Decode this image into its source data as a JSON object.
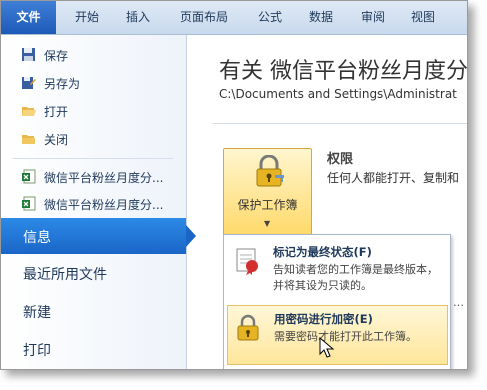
{
  "tabs": [
    {
      "label": "文件"
    },
    {
      "label": "开始"
    },
    {
      "label": "插入"
    },
    {
      "label": "页面布局"
    },
    {
      "label": "公式"
    },
    {
      "label": "数据"
    },
    {
      "label": "审阅"
    },
    {
      "label": "视图"
    }
  ],
  "menu": {
    "save": "保存",
    "save_as": "另存为",
    "open": "打开",
    "close": "关闭",
    "recent1": "微信平台粉丝月度分...",
    "recent2": "微信平台粉丝月度分...",
    "info": "信息",
    "recent_files": "最近所用文件",
    "new": "新建",
    "print": "打印"
  },
  "main": {
    "title": "有关 微信平台粉丝月度分",
    "path": "C:\\Documents and Settings\\Administrat",
    "protect_label": "保护工作簿",
    "perm_title": "权限",
    "perm_desc": "任何人都能打开、复制和"
  },
  "dropdown": {
    "mark_final_title": "标记为最终状态(F)",
    "mark_final_desc": "告知读者您的工作簿是最终版本，并将其设为只读的。",
    "encrypt_title": "用密码进行加密(E)",
    "encrypt_desc": "需要密码才能打开此工作簿。"
  },
  "colors": {
    "accent": "#1a66c7",
    "file_tab": "#2a68c4",
    "highlight": "#ffe69b"
  }
}
